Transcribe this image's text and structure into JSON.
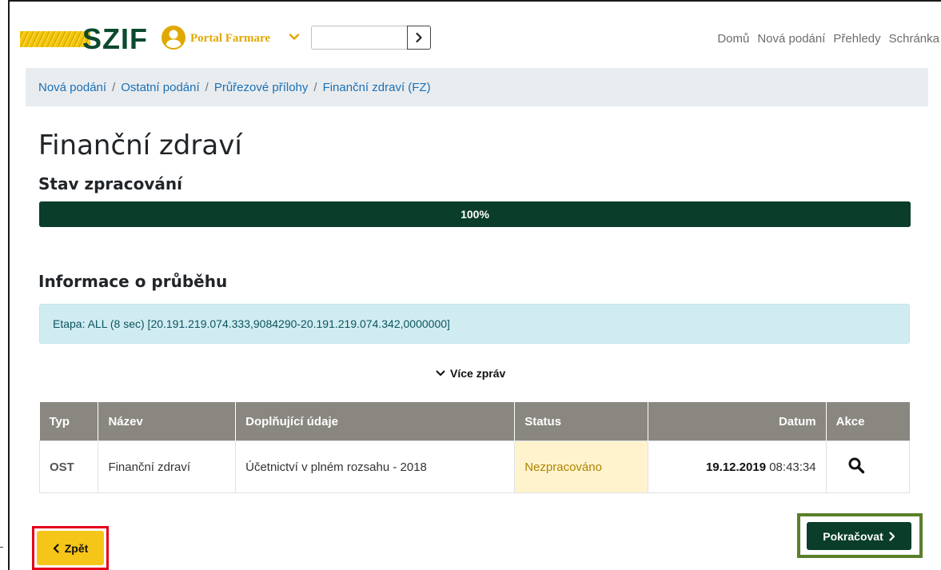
{
  "header": {
    "logo_text": "SZIF",
    "portal_label": "Portal Farmare",
    "search": {
      "value": "",
      "placeholder": ""
    },
    "nav": [
      "Domů",
      "Nová podání",
      "Přehledy",
      "Schránka"
    ]
  },
  "breadcrumb": [
    "Nová podání",
    "Ostatní podání",
    "Průřezové přílohy",
    "Finanční zdraví (FZ)"
  ],
  "page_title": "Finanční zdraví",
  "status_section": {
    "title": "Stav zpracování",
    "progress_label": "100%",
    "progress_fraction": 1.0
  },
  "info": {
    "title": "Informace o průběhu",
    "message": "Etapa: ALL (8 sec) [20.191.219.074.333,9084290-20.191.219.074.342,0000000]"
  },
  "more_messages_label": "Více zpráv",
  "table": {
    "headers": {
      "typ": "Typ",
      "nazev": "Název",
      "doplnujici": "Doplňující údaje",
      "status": "Status",
      "datum": "Datum",
      "akce": "Akce"
    },
    "rows": [
      {
        "typ": "OST",
        "nazev": "Finanční zdraví",
        "doplnujici": "Účetnictví v plném rozsahu - 2018",
        "status": "Nezpracováno",
        "datum_date": "19.12.2019",
        "datum_time": "08:43:34",
        "akce_icon": "search-icon"
      }
    ]
  },
  "buttons": {
    "back_label": "Zpět",
    "continue_label": "Pokračovat"
  },
  "colors": {
    "brand_green": "#0a3d2a",
    "brand_yellow": "#f5c518",
    "status_pending_bg": "#fff3cd",
    "highlight_red": "#e3001b",
    "highlight_green": "#5b7f2a"
  }
}
